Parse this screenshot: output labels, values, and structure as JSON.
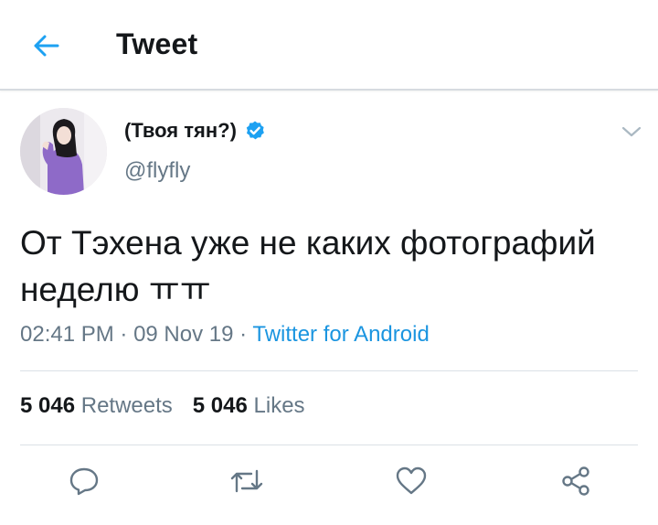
{
  "header": {
    "title": "Tweet",
    "back_icon": "arrow-left-icon"
  },
  "tweet": {
    "display_name": "(Твоя тян?)",
    "verified": true,
    "handle": "@flyfly",
    "text_line1": "От Тэхена уже не каких фотографий",
    "text_line2": "неделю ㅠㅠ",
    "time": "02:41 PM",
    "dot1": " · ",
    "date": "09 Nov 19",
    "dot2": " · ",
    "source": "Twitter for Android"
  },
  "stats": {
    "retweets_count": "5 046",
    "retweets_label": "Retweets",
    "likes_count": "5 046",
    "likes_label": "Likes"
  },
  "actions": [
    "reply-icon",
    "retweet-icon",
    "like-icon",
    "share-icon"
  ],
  "colors": {
    "accent": "#1da1f2",
    "link": "#1b95e0",
    "muted": "#657786",
    "text": "#14171a",
    "divider": "#dbe1e6",
    "avatar_sweater": "#8e6ac8"
  }
}
